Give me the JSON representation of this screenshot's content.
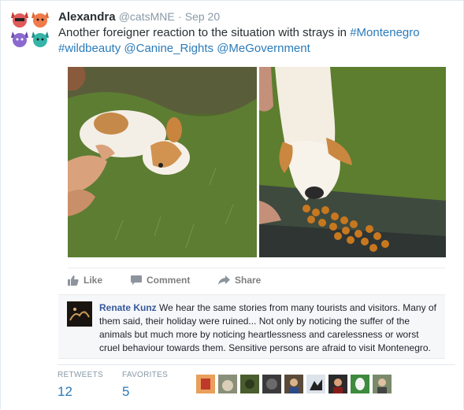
{
  "tweet": {
    "author_name": "Alexandra",
    "author_handle": "@catsMNE",
    "separator": "·",
    "date": "Sep 20",
    "text_plain": "Another foreigner reaction to the situation with strays in ",
    "hashtag_montenegro": "#Montenegro",
    "hashtag_wildbeauty": "#wildbeauty",
    "mention_canine": "@Canine_Rights",
    "mention_megov": "@MeGovernment"
  },
  "actions": {
    "like": "Like",
    "comment": "Comment",
    "share": "Share"
  },
  "comment": {
    "author": "Renate Kunz",
    "text": "We hear the same stories from many tourists and visitors. Many of them said, their holiday were ruined... Not only by noticing the suffer of the animals but much more by noticing heartlessness and carelessness or worst cruel behaviour towards them. Sensitive persons are afraid to visit Montenegro."
  },
  "stats": {
    "retweets_label": "RETWEETS",
    "retweets_value": "12",
    "favorites_label": "FAVORITES",
    "favorites_value": "5"
  },
  "icons": {
    "like": "thumbs-up-icon",
    "comment": "speech-bubble-icon",
    "share": "share-arrow-icon"
  },
  "colors": {
    "link": "#2b7bb9",
    "muted": "#8899a6",
    "fb_link": "#365899"
  }
}
